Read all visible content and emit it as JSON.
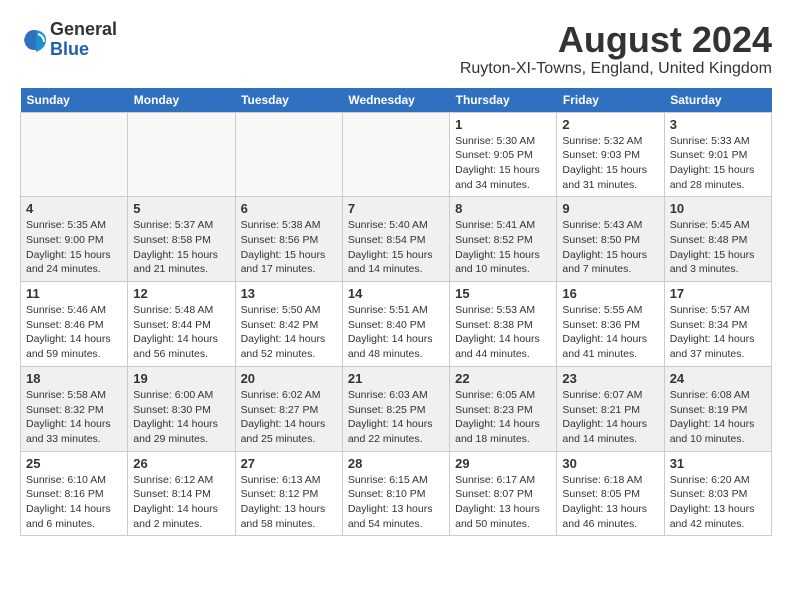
{
  "header": {
    "logo_general": "General",
    "logo_blue": "Blue",
    "month_year": "August 2024",
    "location": "Ruyton-XI-Towns, England, United Kingdom"
  },
  "weekdays": [
    "Sunday",
    "Monday",
    "Tuesday",
    "Wednesday",
    "Thursday",
    "Friday",
    "Saturday"
  ],
  "weeks": [
    [
      {
        "day": "",
        "info": ""
      },
      {
        "day": "",
        "info": ""
      },
      {
        "day": "",
        "info": ""
      },
      {
        "day": "",
        "info": ""
      },
      {
        "day": "1",
        "info": "Sunrise: 5:30 AM\nSunset: 9:05 PM\nDaylight: 15 hours\nand 34 minutes."
      },
      {
        "day": "2",
        "info": "Sunrise: 5:32 AM\nSunset: 9:03 PM\nDaylight: 15 hours\nand 31 minutes."
      },
      {
        "day": "3",
        "info": "Sunrise: 5:33 AM\nSunset: 9:01 PM\nDaylight: 15 hours\nand 28 minutes."
      }
    ],
    [
      {
        "day": "4",
        "info": "Sunrise: 5:35 AM\nSunset: 9:00 PM\nDaylight: 15 hours\nand 24 minutes."
      },
      {
        "day": "5",
        "info": "Sunrise: 5:37 AM\nSunset: 8:58 PM\nDaylight: 15 hours\nand 21 minutes."
      },
      {
        "day": "6",
        "info": "Sunrise: 5:38 AM\nSunset: 8:56 PM\nDaylight: 15 hours\nand 17 minutes."
      },
      {
        "day": "7",
        "info": "Sunrise: 5:40 AM\nSunset: 8:54 PM\nDaylight: 15 hours\nand 14 minutes."
      },
      {
        "day": "8",
        "info": "Sunrise: 5:41 AM\nSunset: 8:52 PM\nDaylight: 15 hours\nand 10 minutes."
      },
      {
        "day": "9",
        "info": "Sunrise: 5:43 AM\nSunset: 8:50 PM\nDaylight: 15 hours\nand 7 minutes."
      },
      {
        "day": "10",
        "info": "Sunrise: 5:45 AM\nSunset: 8:48 PM\nDaylight: 15 hours\nand 3 minutes."
      }
    ],
    [
      {
        "day": "11",
        "info": "Sunrise: 5:46 AM\nSunset: 8:46 PM\nDaylight: 14 hours\nand 59 minutes."
      },
      {
        "day": "12",
        "info": "Sunrise: 5:48 AM\nSunset: 8:44 PM\nDaylight: 14 hours\nand 56 minutes."
      },
      {
        "day": "13",
        "info": "Sunrise: 5:50 AM\nSunset: 8:42 PM\nDaylight: 14 hours\nand 52 minutes."
      },
      {
        "day": "14",
        "info": "Sunrise: 5:51 AM\nSunset: 8:40 PM\nDaylight: 14 hours\nand 48 minutes."
      },
      {
        "day": "15",
        "info": "Sunrise: 5:53 AM\nSunset: 8:38 PM\nDaylight: 14 hours\nand 44 minutes."
      },
      {
        "day": "16",
        "info": "Sunrise: 5:55 AM\nSunset: 8:36 PM\nDaylight: 14 hours\nand 41 minutes."
      },
      {
        "day": "17",
        "info": "Sunrise: 5:57 AM\nSunset: 8:34 PM\nDaylight: 14 hours\nand 37 minutes."
      }
    ],
    [
      {
        "day": "18",
        "info": "Sunrise: 5:58 AM\nSunset: 8:32 PM\nDaylight: 14 hours\nand 33 minutes."
      },
      {
        "day": "19",
        "info": "Sunrise: 6:00 AM\nSunset: 8:30 PM\nDaylight: 14 hours\nand 29 minutes."
      },
      {
        "day": "20",
        "info": "Sunrise: 6:02 AM\nSunset: 8:27 PM\nDaylight: 14 hours\nand 25 minutes."
      },
      {
        "day": "21",
        "info": "Sunrise: 6:03 AM\nSunset: 8:25 PM\nDaylight: 14 hours\nand 22 minutes."
      },
      {
        "day": "22",
        "info": "Sunrise: 6:05 AM\nSunset: 8:23 PM\nDaylight: 14 hours\nand 18 minutes."
      },
      {
        "day": "23",
        "info": "Sunrise: 6:07 AM\nSunset: 8:21 PM\nDaylight: 14 hours\nand 14 minutes."
      },
      {
        "day": "24",
        "info": "Sunrise: 6:08 AM\nSunset: 8:19 PM\nDaylight: 14 hours\nand 10 minutes."
      }
    ],
    [
      {
        "day": "25",
        "info": "Sunrise: 6:10 AM\nSunset: 8:16 PM\nDaylight: 14 hours\nand 6 minutes."
      },
      {
        "day": "26",
        "info": "Sunrise: 6:12 AM\nSunset: 8:14 PM\nDaylight: 14 hours\nand 2 minutes."
      },
      {
        "day": "27",
        "info": "Sunrise: 6:13 AM\nSunset: 8:12 PM\nDaylight: 13 hours\nand 58 minutes."
      },
      {
        "day": "28",
        "info": "Sunrise: 6:15 AM\nSunset: 8:10 PM\nDaylight: 13 hours\nand 54 minutes."
      },
      {
        "day": "29",
        "info": "Sunrise: 6:17 AM\nSunset: 8:07 PM\nDaylight: 13 hours\nand 50 minutes."
      },
      {
        "day": "30",
        "info": "Sunrise: 6:18 AM\nSunset: 8:05 PM\nDaylight: 13 hours\nand 46 minutes."
      },
      {
        "day": "31",
        "info": "Sunrise: 6:20 AM\nSunset: 8:03 PM\nDaylight: 13 hours\nand 42 minutes."
      }
    ]
  ]
}
